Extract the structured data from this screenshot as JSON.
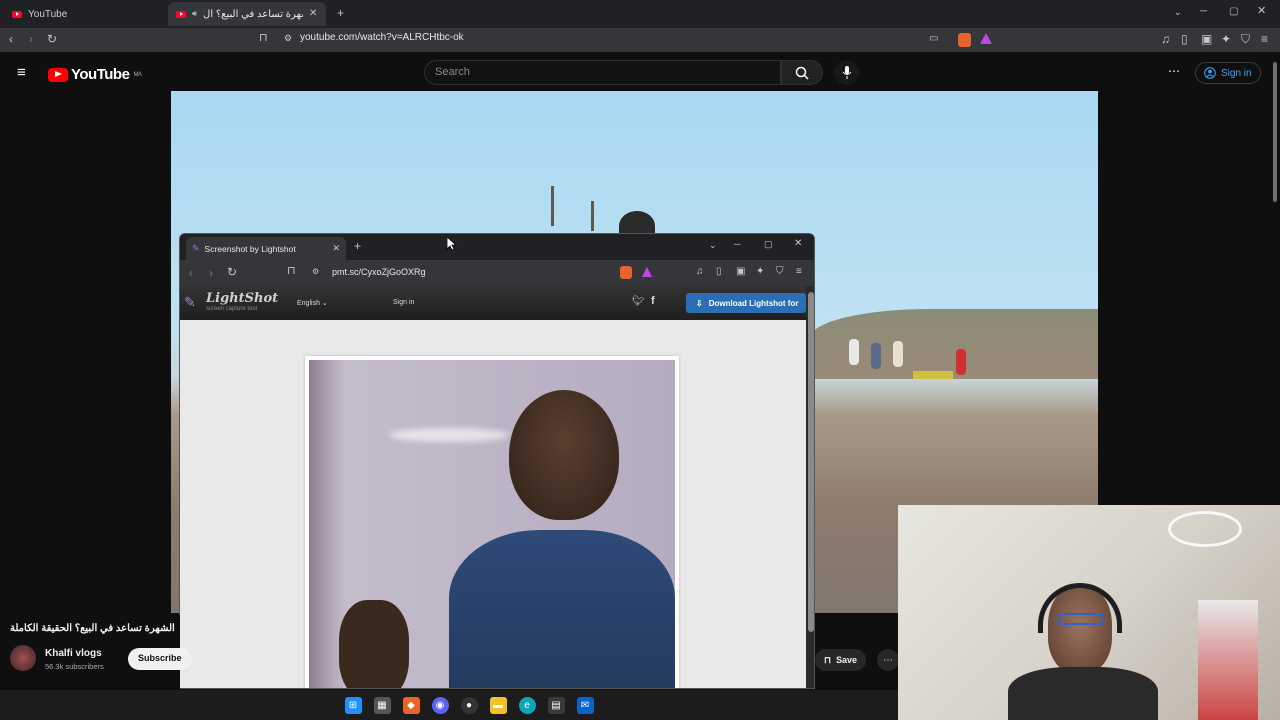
{
  "browser": {
    "tabs": [
      {
        "label": "YouTube"
      },
      {
        "label": "حل الشهرة تساعد في البيع؟ ال"
      }
    ],
    "new_tab": "+",
    "url": "youtube.com/watch?v=ALRCHtbc-ok"
  },
  "youtube": {
    "logo_text": "YouTube",
    "region": "MA",
    "search_placeholder": "Search",
    "signin": "Sign in"
  },
  "popup": {
    "tab_title": "Screenshot by Lightshot",
    "url": "pmt.sc/CyxoZjGoOXRg",
    "logo": "LightShot",
    "tagline": "screen capture tool",
    "language": "English",
    "signin": "Sign in",
    "download": "Download Lightshot for"
  },
  "video_info": {
    "title": "الشهرة تساعد في البيع؟ الحقيقة الكاملة",
    "channel": "Khalfi vlogs",
    "subscribers": "56.3k subscribers",
    "subscribe": "Subscribe",
    "save": "Save"
  },
  "colors": {
    "yt_red": "#ff0000",
    "signin_blue": "#3ea6ff",
    "download_blue": "#2a6fb5"
  },
  "icons": [
    "menu-icon",
    "search-icon",
    "mic-icon",
    "more-icon",
    "user-icon",
    "bookmark-icon",
    "reload-icon",
    "back-icon",
    "forward-icon",
    "twitter-icon",
    "facebook-icon",
    "windows-icon"
  ]
}
